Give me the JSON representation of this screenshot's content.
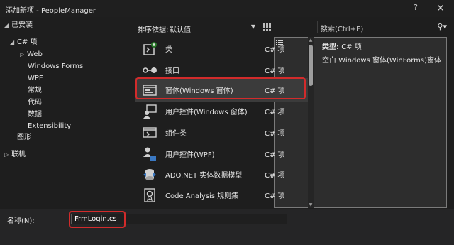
{
  "window": {
    "title": "添加新项 - PeopleManager",
    "help_label": "?",
    "close_label": "✕"
  },
  "tree": {
    "installed": "已安装",
    "csharp": "C# 项",
    "web": "Web",
    "windows_forms": "Windows Forms",
    "wpf": "WPF",
    "general": "常规",
    "code": "代码",
    "data": "数据",
    "extensibility": "Extensibility",
    "graphics": "图形",
    "online": "联机"
  },
  "toolbar": {
    "sort_label": "排序依据:",
    "sort_value": "默认值"
  },
  "items": [
    {
      "name": "类",
      "lang": "C# 项",
      "icon": "class-icon"
    },
    {
      "name": "接口",
      "lang": "C# 项",
      "icon": "interface-icon"
    },
    {
      "name": "窗体(Windows 窗体)",
      "lang": "C# 项",
      "icon": "form-icon",
      "selected": true
    },
    {
      "name": "用户控件(Windows 窗体)",
      "lang": "C# 项",
      "icon": "user-control-icon"
    },
    {
      "name": "组件类",
      "lang": "C# 项",
      "icon": "component-class-icon"
    },
    {
      "name": "用户控件(WPF)",
      "lang": "C# 项",
      "icon": "wpf-user-control-icon"
    },
    {
      "name": "ADO.NET 实体数据模型",
      "lang": "C# 项",
      "icon": "entity-model-icon"
    },
    {
      "name": "Code Analysis 规则集",
      "lang": "C# 项",
      "icon": "ruleset-icon"
    }
  ],
  "details": {
    "search_placeholder": "搜索(Ctrl+E)",
    "type_label": "类型:",
    "type_value": "C# 项",
    "description": "空白 Windows 窗体(WinForms)窗体"
  },
  "name_field": {
    "label_prefix": "名称(",
    "label_accel": "N",
    "label_suffix": "):",
    "value": "FrmLogin.cs"
  },
  "colors": {
    "background": "#1e1e1e",
    "highlight": "#d22b2b",
    "selected_row": "#3b3b3b"
  }
}
